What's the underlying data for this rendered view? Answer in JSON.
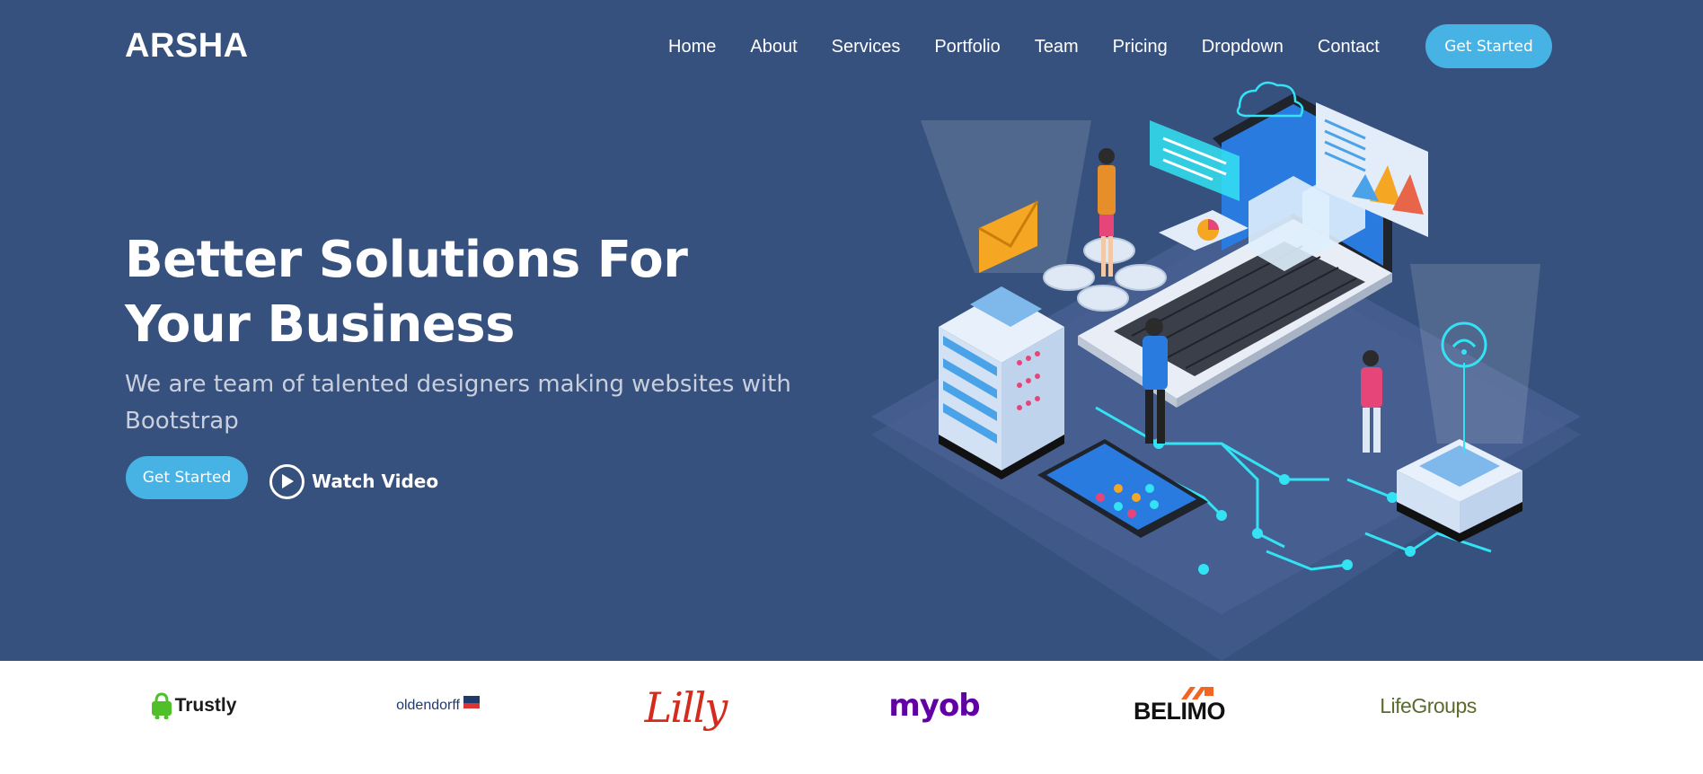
{
  "header": {
    "logo": "ARSHA",
    "nav": [
      "Home",
      "About",
      "Services",
      "Portfolio",
      "Team",
      "Pricing",
      "Dropdown",
      "Contact"
    ],
    "cta": "Get Started"
  },
  "hero": {
    "title": "Better Solutions For Your Business",
    "subtitle": "We are team of talented designers making websites with Bootstrap",
    "cta": "Get Started",
    "watch_label": "Watch Video",
    "play_icon": "play-circle-icon"
  },
  "clients": [
    "Trustly",
    "oldendorff",
    "Lilly",
    "myob",
    "BELIMO",
    "LifeGroups"
  ],
  "colors": {
    "hero_bg": "#37517e",
    "accent": "#47b2e4",
    "white": "#ffffff",
    "subtitle": "#c9cfdc"
  }
}
